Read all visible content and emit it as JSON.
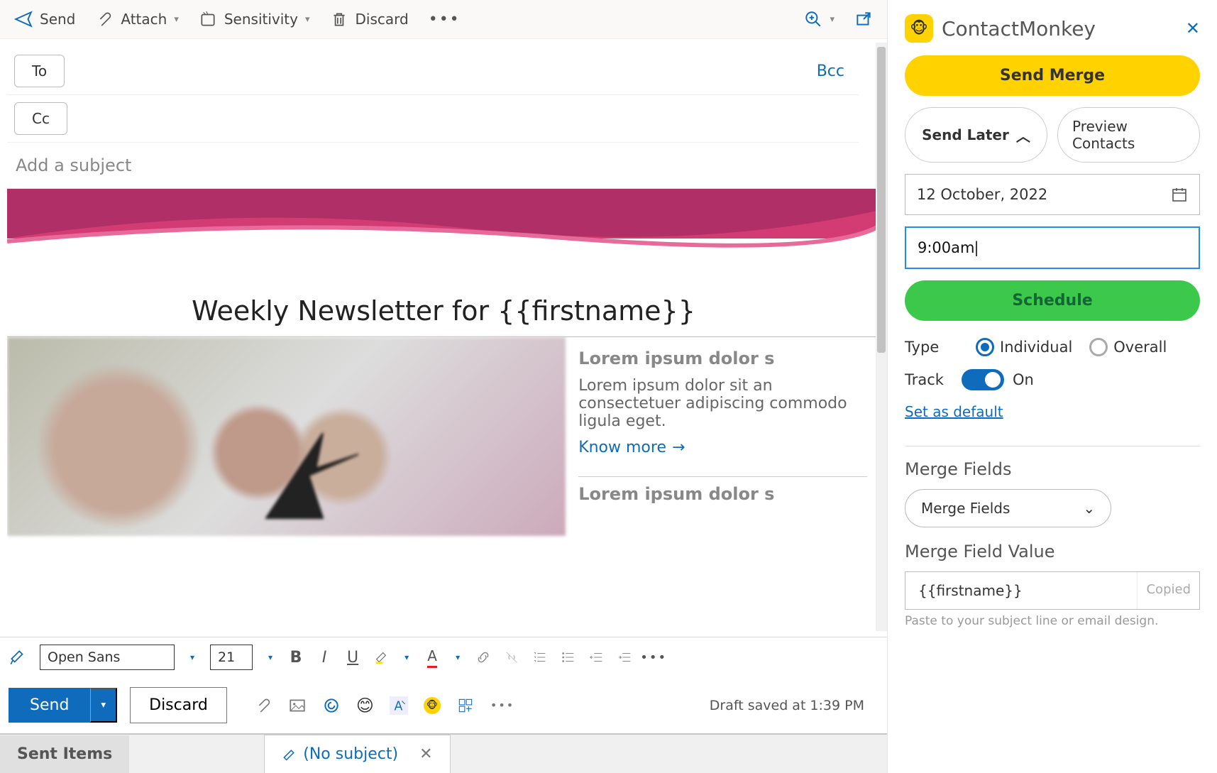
{
  "toolbar": {
    "send": "Send",
    "attach": "Attach",
    "sensitivity": "Sensitivity",
    "discard": "Discard"
  },
  "compose": {
    "to": "To",
    "cc": "Cc",
    "bcc": "Bcc",
    "subject_placeholder": "Add a subject"
  },
  "body": {
    "title": "Weekly Newsletter for {{firstname}}",
    "lorem_heading": "Lorem ipsum dolor s",
    "lorem_text": "Lorem ipsum dolor sit an consectetuer adipiscing commodo ligula eget.",
    "know_more": "Know more",
    "lorem_heading2": "Lorem ipsum dolor s"
  },
  "format": {
    "font": "Open Sans",
    "size": "21"
  },
  "bottom": {
    "send": "Send",
    "discard": "Discard",
    "draft": "Draft saved at 1:39 PM"
  },
  "tabs": {
    "sent": "Sent Items",
    "nosub": "(No subject)"
  },
  "side": {
    "brand": "ContactMonkey",
    "send_merge": "Send Merge",
    "send_later": "Send Later",
    "preview": "Preview Contacts",
    "date": "12 October, 2022",
    "time": "9:00am",
    "schedule": "Schedule",
    "type": "Type",
    "individual": "Individual",
    "overall": "Overall",
    "track": "Track",
    "on": "On",
    "default": "Set as default",
    "merge_fields": "Merge Fields",
    "merge_dd": "Merge Fields",
    "value_label": "Merge Field Value",
    "value": "{{firstname}}",
    "copied": "Copied",
    "hint": "Paste to your subject line or email design."
  }
}
